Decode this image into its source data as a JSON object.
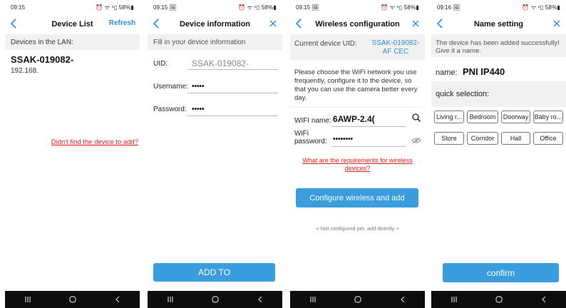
{
  "status": {
    "s1": {
      "time": "09:15",
      "right": "⏰ ᯤ ⁿ▯ 58%▮"
    },
    "s2": {
      "time": "09:15 🖼",
      "right": "⏰ ᯤ ⁿ▯ 58%▮"
    },
    "s3": {
      "time": "09:15 🖼",
      "right": "⏰ ᯤ ⁿ▯ 58%▮"
    },
    "s4": {
      "time": "09:16 🖼",
      "right": "⏰ ᯤ ⁿ▯ 58%▮"
    }
  },
  "screen1": {
    "title": "Device List",
    "refresh": "Refresh",
    "section": "Devices in the LAN:",
    "device_name": "SSAK-019082-",
    "device_ip": "192.168.",
    "not_found_link": "Didn't find the device to add?"
  },
  "screen2": {
    "title": "Device information",
    "hint": "Fill in your device information",
    "uid_label": "UID:",
    "uid_value": "SSAK-019082-",
    "username_label": "Username:",
    "username_value": "•••••",
    "password_label": "Password:",
    "password_value": "•••••",
    "add_button": "ADD TO"
  },
  "screen3": {
    "title": "Wireless configuration",
    "uid_label": "Current device UID:",
    "uid_value": "SSAK-019082-AF CEC",
    "instructions": "Please choose the WiFi network you use frequently, configure it to the device, so that you can use the camera better every day.",
    "wifi_name_label": "WIFI name:",
    "wifi_name_value": "6AWP-2.4(",
    "wifi_pw_label": "WiFi password:",
    "wifi_pw_value": "••••••••",
    "requirements_link": "What are the requirements for wireless devices?",
    "configure_button": "Configure wireless and add",
    "skip_link": "< Not configured yet, add directly >"
  },
  "screen4": {
    "title": "Name setting",
    "success_msg": "The device has been added successfully! Give it a name.",
    "name_label": "name:",
    "name_value": "PNI IP440",
    "quick_label": "quick selection:",
    "chips": [
      "Living r...",
      "Bedroom",
      "Doorway",
      "Baby ro...",
      "Store",
      "Corridor",
      "Hall",
      "Office"
    ],
    "confirm_button": "confirm"
  },
  "colors": {
    "accent": "#3a9ede",
    "link_red": "#e02020",
    "navbar": "#0d0d0d"
  },
  "icons": [
    "back-arrow-icon",
    "close-icon",
    "search-icon",
    "eye-icon",
    "recent-apps-icon",
    "home-icon",
    "nav-back-icon"
  ]
}
